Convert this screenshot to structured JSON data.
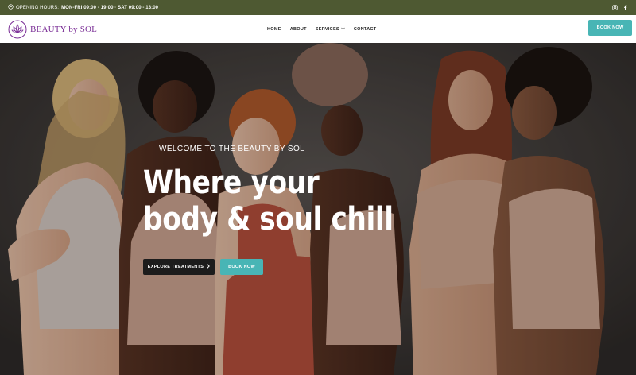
{
  "topbar": {
    "hours_prefix": "OPENING HOURS:",
    "hours_value": "MON-FRI 09:00 - 19:00 · SAT 09:00 - 13:00",
    "social_icons": [
      "instagram-icon",
      "facebook-icon"
    ]
  },
  "brand": {
    "name": "BEAUTY by SOL",
    "color": "#7a2e96"
  },
  "nav": {
    "items": [
      {
        "label": "HOME"
      },
      {
        "label": "ABOUT"
      },
      {
        "label": "SERVICES"
      },
      {
        "label": "CONTACT"
      }
    ],
    "book_label": "BOOK NOW"
  },
  "hero": {
    "welcome": "WELCOME TO THE BEAUTY BY SOL",
    "headline_line1": "Where your",
    "headline_line2": "body & soul chill",
    "explore_label": "EXPLORE TREATMENTS",
    "book_label": "BOOK NOW"
  },
  "colors": {
    "topbar": "#4e5932",
    "accent": "#48b5b5",
    "dark_button": "#1c1c1c"
  }
}
